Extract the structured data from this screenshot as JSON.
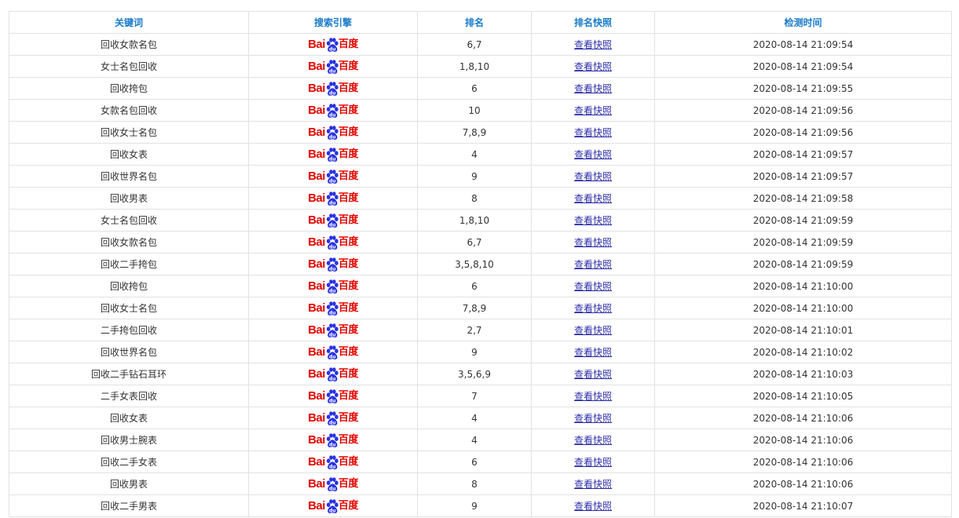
{
  "table": {
    "headers": {
      "keyword": "关键词",
      "engine": "搜索引擎",
      "rank": "排名",
      "snapshot": "排名快照",
      "time": "检测时间"
    },
    "engine_logo": {
      "latin": "Bai",
      "chinese": "百度",
      "icon": "baidu-paw-icon",
      "color": "#e10601",
      "paw_color": "#2932e1"
    },
    "snapshot_link_text": "查看快照",
    "rows": [
      {
        "keyword": "回收女款名包",
        "rank": "6,7",
        "time": "2020-08-14 21:09:54"
      },
      {
        "keyword": "女士名包回收",
        "rank": "1,8,10",
        "time": "2020-08-14 21:09:54"
      },
      {
        "keyword": "回收挎包",
        "rank": "6",
        "time": "2020-08-14 21:09:55"
      },
      {
        "keyword": "女款名包回收",
        "rank": "10",
        "time": "2020-08-14 21:09:56"
      },
      {
        "keyword": "回收女士名包",
        "rank": "7,8,9",
        "time": "2020-08-14 21:09:56"
      },
      {
        "keyword": "回收女表",
        "rank": "4",
        "time": "2020-08-14 21:09:57"
      },
      {
        "keyword": "回收世界名包",
        "rank": "9",
        "time": "2020-08-14 21:09:57"
      },
      {
        "keyword": "回收男表",
        "rank": "8",
        "time": "2020-08-14 21:09:58"
      },
      {
        "keyword": "女士名包回收",
        "rank": "1,8,10",
        "time": "2020-08-14 21:09:59"
      },
      {
        "keyword": "回收女款名包",
        "rank": "6,7",
        "time": "2020-08-14 21:09:59"
      },
      {
        "keyword": "回收二手挎包",
        "rank": "3,5,8,10",
        "time": "2020-08-14 21:09:59"
      },
      {
        "keyword": "回收挎包",
        "rank": "6",
        "time": "2020-08-14 21:10:00"
      },
      {
        "keyword": "回收女士名包",
        "rank": "7,8,9",
        "time": "2020-08-14 21:10:00"
      },
      {
        "keyword": "二手挎包回收",
        "rank": "2,7",
        "time": "2020-08-14 21:10:01"
      },
      {
        "keyword": "回收世界名包",
        "rank": "9",
        "time": "2020-08-14 21:10:02"
      },
      {
        "keyword": "回收二手钻石耳环",
        "rank": "3,5,6,9",
        "time": "2020-08-14 21:10:03"
      },
      {
        "keyword": "二手女表回收",
        "rank": "7",
        "time": "2020-08-14 21:10:05"
      },
      {
        "keyword": "回收女表",
        "rank": "4",
        "time": "2020-08-14 21:10:06"
      },
      {
        "keyword": "回收男士腕表",
        "rank": "4",
        "time": "2020-08-14 21:10:06"
      },
      {
        "keyword": "回收二手女表",
        "rank": "6",
        "time": "2020-08-14 21:10:06"
      },
      {
        "keyword": "回收男表",
        "rank": "8",
        "time": "2020-08-14 21:10:06"
      },
      {
        "keyword": "回收二手男表",
        "rank": "9",
        "time": "2020-08-14 21:10:07"
      }
    ]
  }
}
